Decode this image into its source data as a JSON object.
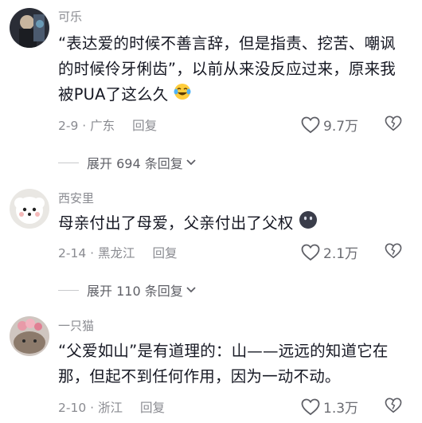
{
  "comments": [
    {
      "username": "可乐",
      "text_before": "“表达爱的时候不善言辞，但是指责、挖苦、嘲讽的时候伶牙俐齿”，以前从来没反应过来，原来我被PUA了这么久",
      "emoji": "laughing-tears-emoji",
      "date_location": "2-9 · 广东",
      "reply_label": "回复",
      "likes": "9.7万",
      "expand_label": "展开 694 条回复"
    },
    {
      "username": "西安里",
      "text_before": "母亲付出了母爱，父亲付出了父权",
      "emoji": "dark-face-emoji",
      "date_location": "2-14 · 黑龙江",
      "reply_label": "回复",
      "likes": "2.1万",
      "expand_label": "展开 110 条回复"
    },
    {
      "username": "一只猫",
      "text_before": "“父爱如山”是有道理的：山——远远的知道它在那，但起不到任何作用，因为一动不动。",
      "date_location": "2-10 · 浙江",
      "reply_label": "回复",
      "likes": "1.3万"
    }
  ],
  "colors": {
    "text": "#161823",
    "meta": "#8a8b91"
  }
}
